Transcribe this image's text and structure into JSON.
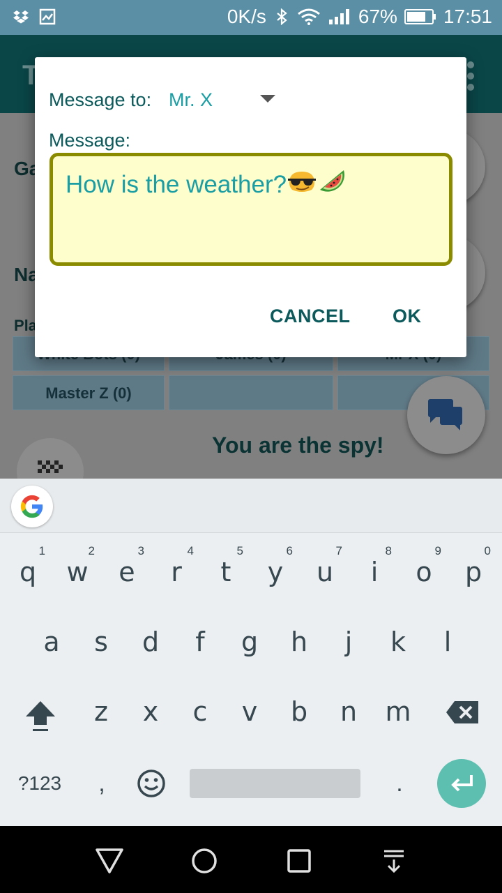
{
  "status_bar": {
    "net_speed": "0K/s",
    "battery_pct": "67%",
    "time": "17:51",
    "icons": [
      "dropbox-icon",
      "image-icon",
      "bluetooth-icon",
      "wifi-icon",
      "signal-icon",
      "battery-icon"
    ]
  },
  "app": {
    "toolbar_title": "T",
    "game_label": "Ga",
    "name_label": "Na",
    "players_label": "Pla",
    "players": [
      "White Bots (0)",
      "James (0)",
      "Mr X (0)",
      "Master Z (0)",
      "",
      ""
    ],
    "spy_text": "You are the spy!"
  },
  "dialog": {
    "to_label": "Message to:",
    "to_value": "Mr. X",
    "message_label": "Message:",
    "message_text": "How is the weather?",
    "emojis": [
      "sunglasses-emoji",
      "watermelon-emoji"
    ],
    "cancel_label": "CANCEL",
    "ok_label": "OK"
  },
  "keyboard": {
    "row1": [
      {
        "ch": "q",
        "hint": "1"
      },
      {
        "ch": "w",
        "hint": "2"
      },
      {
        "ch": "e",
        "hint": "3"
      },
      {
        "ch": "r",
        "hint": "4"
      },
      {
        "ch": "t",
        "hint": "5"
      },
      {
        "ch": "y",
        "hint": "6"
      },
      {
        "ch": "u",
        "hint": "7"
      },
      {
        "ch": "i",
        "hint": "8"
      },
      {
        "ch": "o",
        "hint": "9"
      },
      {
        "ch": "p",
        "hint": "0"
      }
    ],
    "row2": [
      "a",
      "s",
      "d",
      "f",
      "g",
      "h",
      "j",
      "k",
      "l"
    ],
    "row3": [
      "z",
      "x",
      "c",
      "v",
      "b",
      "n",
      "m"
    ],
    "symbols_label": "?123",
    "comma": ",",
    "period": "."
  },
  "colors": {
    "accent": "#1a9ea4",
    "dialog_text": "#0c5a5b",
    "input_bg": "#fefdcc",
    "input_border": "#8b8b00",
    "enter_key": "#5cbfb0"
  }
}
